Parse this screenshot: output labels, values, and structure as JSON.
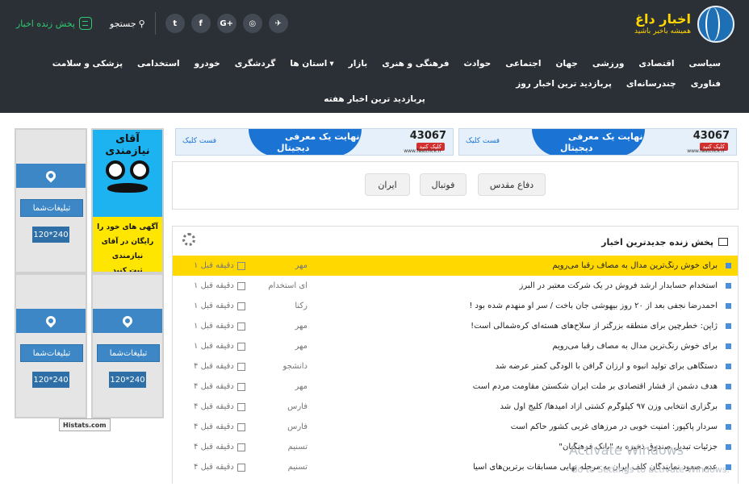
{
  "logo": {
    "title": "اخبار داغ",
    "subtitle": "همیشه باخبر باشید"
  },
  "topbar": {
    "live": "پخش زنده اخبار",
    "search": "جستجو"
  },
  "social": [
    "telegram-icon",
    "instagram-icon",
    "google-plus-icon",
    "facebook-icon",
    "twitter-icon"
  ],
  "social_glyphs": [
    "✈",
    "◎",
    "G+",
    "f",
    "t"
  ],
  "nav": [
    "سیاسی",
    "اقتصادی",
    "ورزشی",
    "جهان",
    "اجتماعی",
    "حوادث",
    "فرهنگی و هنری",
    "بازار",
    "استان ها",
    "گردشگری",
    "خودرو",
    "استخدامی",
    "پزشکی و سلامت",
    "فناوری",
    "چندرسانه‌ای",
    "پربازدید ترین اخبار روز"
  ],
  "nav_row2": "پربازدید ترین اخبار هفته",
  "banner": {
    "line1": "نهایت یک معرفی",
    "line2": "دیجیتال",
    "number": "43067",
    "click": "کلیک کنید",
    "brand": "فست کلیک",
    "url": "www.fastclick.ir"
  },
  "tags": [
    "دفاع مقدس",
    "فوتبال",
    "ایران"
  ],
  "news": {
    "title": "پخش زنده جدیدترین اخبار",
    "items": [
      {
        "title": "برای خوش رنگ‌ترین مدال به مصاف رقبا می‌رویم",
        "source": "مهر",
        "time": "۱ دقیقه قبل"
      },
      {
        "title": "استخدام حسابدار ارشد فروش در یک شرکت معتبر در البرز",
        "source": "ای استخدام",
        "time": "۱ دقیقه قبل"
      },
      {
        "title": "احمدرضا نجفی بعد از ۲۰ روز بیهوشی جان باخت / سر او منهدم شده بود !",
        "source": "رکنا",
        "time": "۱ دقیقه قبل"
      },
      {
        "title": "ژاپن: خطرچین برای منطقه بزرگتر از سلاح‌های هسته‌ای کره‌شمالی است!",
        "source": "مهر",
        "time": "۱ دقیقه قبل"
      },
      {
        "title": "برای خوش رنگ‌ترین مدال به مصاف رقبا می‌رویم",
        "source": "مهر",
        "time": "۱ دقیقه قبل"
      },
      {
        "title": "دستگاهی برای تولید انبوه و ارزان گرافن با آلودگی کمتر عرضه شد",
        "source": "دانشجو",
        "time": "۴ دقیقه قبل"
      },
      {
        "title": "هدف دشمن از فشار اقتصادی بر ملت ایران شکستن مقاومت مردم است",
        "source": "مهر",
        "time": "۴ دقیقه قبل"
      },
      {
        "title": "برگزاری انتخابی وزن ۹۷ کیلوگرم کشتی آزاد امیدها/ کلیج اول شد",
        "source": "فارس",
        "time": "۴ دقیقه قبل"
      },
      {
        "title": "سردار پاکپور: امنیت خوبی در مرزهای غربی کشور حاکم است",
        "source": "فارس",
        "time": "۴ دقیقه قبل"
      },
      {
        "title": "جزئیات تبدیل صندوق ذخیره به \"بانک فرهنگیان\"",
        "source": "تسنیم",
        "time": "۴ دقیقه قبل"
      },
      {
        "title": "عدم صعود نمایندگان کلف ایران به مرحله نهایی مسابقات برترین‌های آسیا",
        "source": "تسنیم",
        "time": "۴ دقیقه قبل"
      }
    ]
  },
  "ads": {
    "label": "تبلیغات‌شما",
    "size": "120*240",
    "mister_title": "آقای نیازمندی",
    "mister_text1": "آگهی های خود را",
    "mister_text2": "رایگان در آقای نیازمندی",
    "mister_text3": "ثبت کنید"
  },
  "histats": "Histats.com",
  "watermark": {
    "title": "Activate Windows",
    "sub": "Go to Settings to activate Windows."
  },
  "colors": {
    "header": "#2b2f36",
    "accent": "#1b73d3",
    "highlight": "#ffd800",
    "live": "#2ecc71",
    "logo": "#ffd700"
  }
}
